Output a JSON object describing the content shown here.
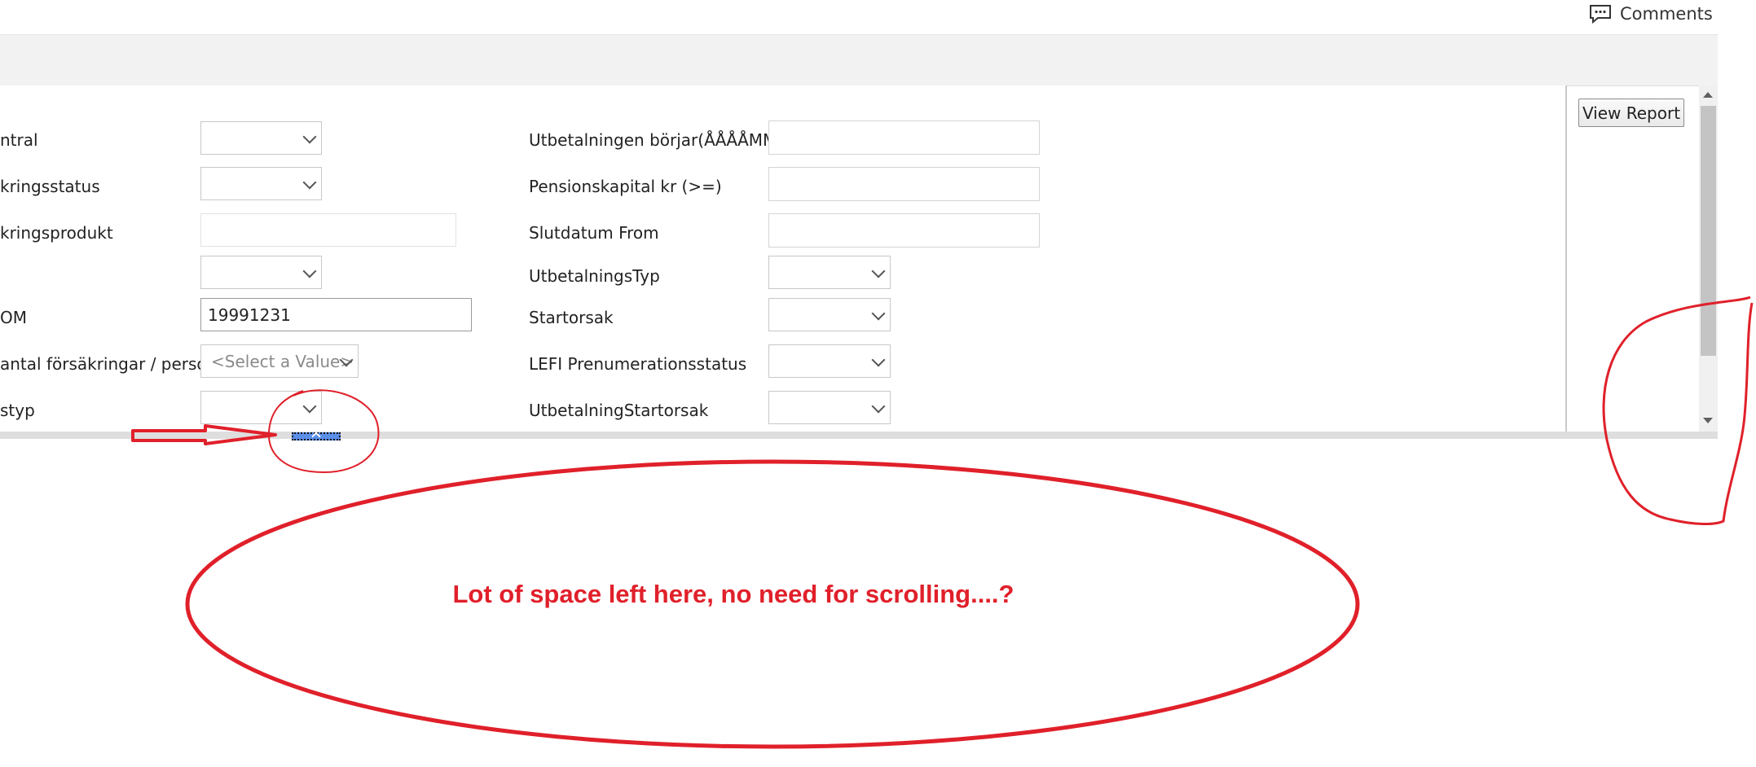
{
  "header": {
    "comments_label": "Comments"
  },
  "params_left": [
    {
      "label": "ntral",
      "control": "dropdown",
      "value": ""
    },
    {
      "label": "kringsstatus",
      "control": "dropdown",
      "value": ""
    },
    {
      "label": "kringsprodukt",
      "control": "multiselect",
      "value": ""
    },
    {
      "label": "",
      "control": "dropdown",
      "value": ""
    },
    {
      "label": "OM",
      "control": "text",
      "value": "19991231"
    },
    {
      "label": "antal försäkringar / person",
      "control": "dropdown",
      "value": "<Select a Value>"
    },
    {
      "label": "styp",
      "control": "dropdown",
      "value": ""
    }
  ],
  "params_right": [
    {
      "label": "Utbetalningen börjar(ÅÅÅÅMM)",
      "control": "text",
      "value": ""
    },
    {
      "label": "Pensionskapital kr (>=)",
      "control": "text",
      "value": ""
    },
    {
      "label": "Slutdatum From",
      "control": "text",
      "value": ""
    },
    {
      "label": "UtbetalningsTyp",
      "control": "dropdown",
      "value": ""
    },
    {
      "label": "Startorsak",
      "control": "dropdown",
      "value": ""
    },
    {
      "label": "LEFI Prenumerationsstatus",
      "control": "dropdown",
      "value": ""
    },
    {
      "label": "UtbetalningStartorsak",
      "control": "dropdown",
      "value": ""
    }
  ],
  "actions": {
    "view_report_label": "View Report"
  },
  "annotation": {
    "text": "Lot of space left here, no need for scrolling....?",
    "color": "#e0202a"
  },
  "colors": {
    "toolbar_bg": "#f2f2f2",
    "collapse_handle": "#5b8ee6",
    "annotation_red": "#e0202a"
  }
}
